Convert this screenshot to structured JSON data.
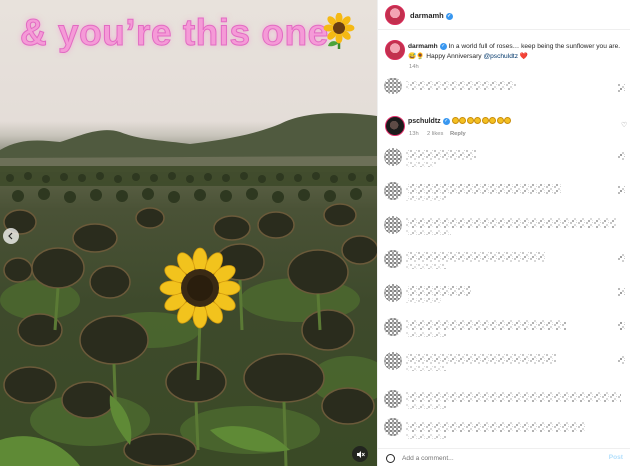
{
  "media": {
    "overlay_text": "& you’re this one",
    "overlay_emoji": "sunflower-emoji",
    "carousel_prev_icon": "chevron-left-icon",
    "mute_icon": "speaker-muted-icon"
  },
  "post": {
    "author": "darmamh",
    "verified": true
  },
  "caption": {
    "username": "darmamh",
    "text": "In a world full of roses… keep being the sunflower you are. 😅🌻 Happy Anniversary ",
    "mention": "@pschuldtz",
    "trailing_emoji": "❤️",
    "timestamp": "14h"
  },
  "comments": [
    {
      "username": "pschuldtz",
      "verified": true,
      "sunflower_count": 8,
      "time": "13h",
      "likes": "2 likes",
      "reply_label": "Reply"
    }
  ],
  "composer": {
    "placeholder": "Add a comment...",
    "post_label": "Post"
  },
  "colors": {
    "overlay_text": "#f59ad7",
    "verified": "#3897f0",
    "link": "#00376b",
    "post_button": "#b2dffc"
  }
}
